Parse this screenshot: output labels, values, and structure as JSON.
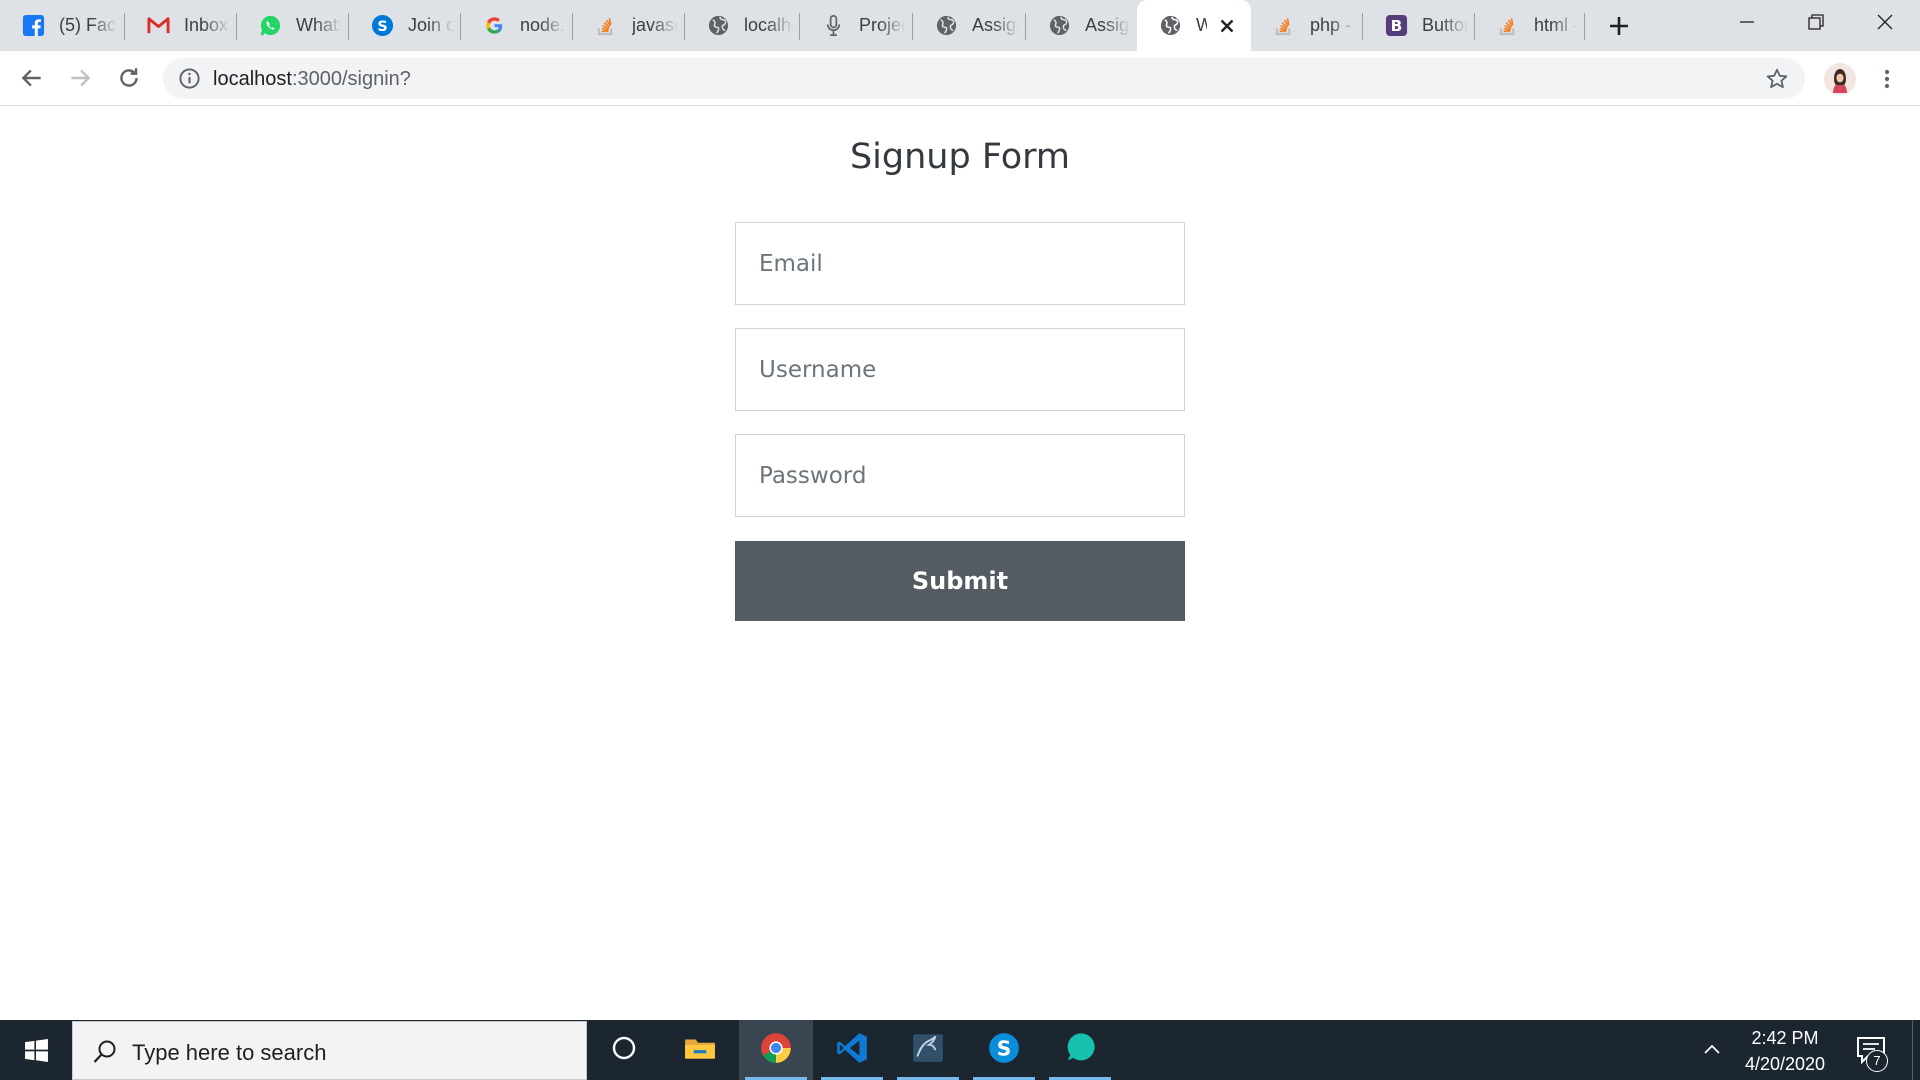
{
  "browser": {
    "tabs": [
      {
        "title": "(5) Fac",
        "icon": "facebook-icon"
      },
      {
        "title": "Inbox (",
        "icon": "gmail-icon"
      },
      {
        "title": "Whats",
        "icon": "whatsapp-icon"
      },
      {
        "title": "Join cc",
        "icon": "skype-icon"
      },
      {
        "title": "node.j",
        "icon": "google-icon"
      },
      {
        "title": "javascr",
        "icon": "stackoverflow-icon"
      },
      {
        "title": "localhc",
        "icon": "globe-icon"
      },
      {
        "title": "Project",
        "icon": "microphone-icon"
      },
      {
        "title": "Assign",
        "icon": "globe-icon"
      },
      {
        "title": "Assign",
        "icon": "globe-icon"
      },
      {
        "title": "Wc",
        "icon": "globe-icon",
        "active": true
      },
      {
        "title": "php - I",
        "icon": "stackoverflow-icon"
      },
      {
        "title": "Button",
        "icon": "bootstrap-icon"
      },
      {
        "title": "html -",
        "icon": "stackoverflow-icon"
      }
    ],
    "address_bar": {
      "host": "localhost",
      "path": ":3000/signin?"
    }
  },
  "page": {
    "title": "Signup Form",
    "email_placeholder": "Email",
    "username_placeholder": "Username",
    "password_placeholder": "Password",
    "submit_label": "Submit"
  },
  "taskbar": {
    "search_placeholder": "Type here to search",
    "apps": [
      "cortana-icon",
      "file-explorer-icon",
      "chrome-icon",
      "vscode-icon",
      "mysql-workbench-icon",
      "skype-icon",
      "app-icon"
    ],
    "time": "2:42 PM",
    "date": "4/20/2020",
    "notification_count": "7"
  },
  "colors": {
    "submit_button": "#545b62",
    "tab_strip": "#dee1e6",
    "taskbar": "#1b2630"
  }
}
